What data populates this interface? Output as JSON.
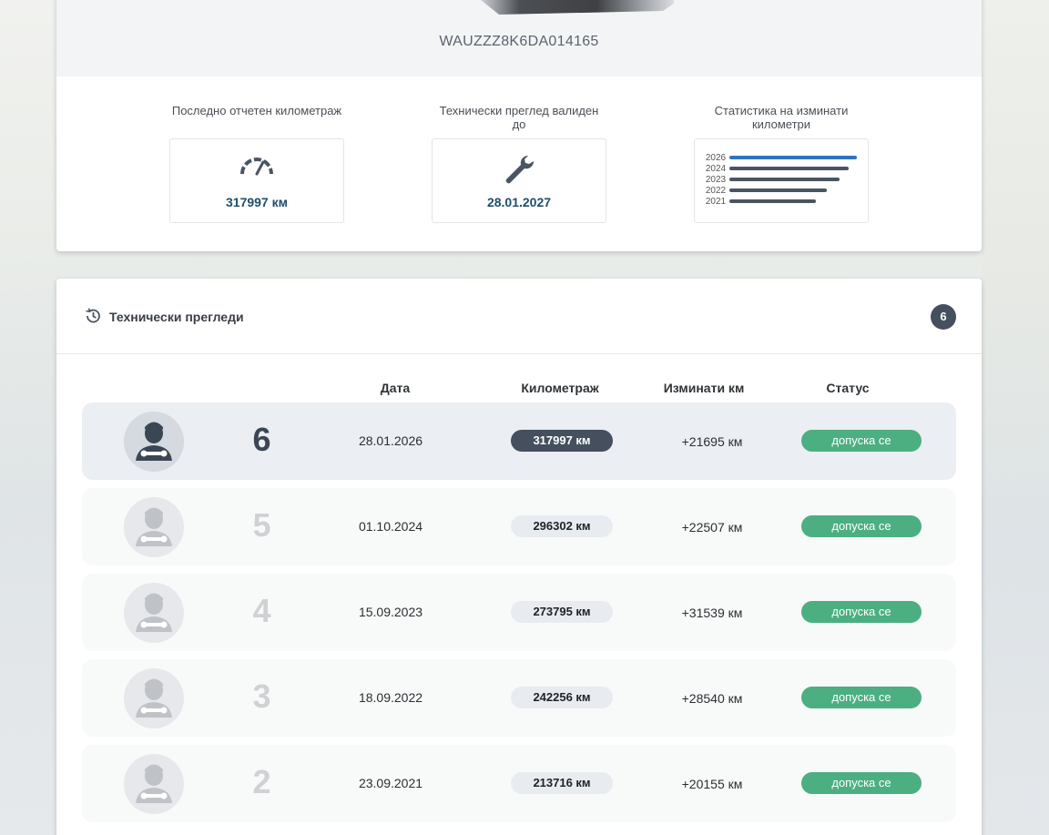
{
  "vehicle": {
    "vin": "WAUZZZ8K6DA014165"
  },
  "stats": {
    "mileage": {
      "label": "Последно отчетен километраж",
      "value": "317997 км",
      "icon": "speedometer-icon"
    },
    "inspection": {
      "label": "Технически преглед валиден до",
      "value": "28.01.2027",
      "icon": "wrench-icon"
    },
    "chart": {
      "label": "Статистика на изминати километри",
      "chart_data": {
        "type": "bar",
        "categories": [
          "2026",
          "2024",
          "2023",
          "2022",
          "2021"
        ],
        "values": [
          317997,
          296302,
          273795,
          242256,
          213716
        ],
        "highlight_color": "#2f74c0",
        "bar_color": "#4a5563"
      }
    }
  },
  "inspections": {
    "title": "Технически прегледи",
    "count": "6",
    "columns": {
      "date": "Дата",
      "mileage": "Километраж",
      "driven": "Изминати км",
      "status": "Статус"
    },
    "rows": [
      {
        "num": "6",
        "date": "28.01.2026",
        "mileage": "317997 км",
        "driven": "+21695 км",
        "status": "допуска се",
        "active": true
      },
      {
        "num": "5",
        "date": "01.10.2024",
        "mileage": "296302 км",
        "driven": "+22507 км",
        "status": "допуска се",
        "active": false
      },
      {
        "num": "4",
        "date": "15.09.2023",
        "mileage": "273795 км",
        "driven": "+31539 км",
        "status": "допуска се",
        "active": false
      },
      {
        "num": "3",
        "date": "18.09.2022",
        "mileage": "242256 км",
        "driven": "+28540 км",
        "status": "допуска се",
        "active": false
      },
      {
        "num": "2",
        "date": "23.09.2021",
        "mileage": "213716 км",
        "driven": "+20155 км",
        "status": "допуска се",
        "active": false
      }
    ]
  },
  "colors": {
    "accent": "#454f5e",
    "status_ok": "#4caf81",
    "value_text": "#1f4e6b"
  }
}
